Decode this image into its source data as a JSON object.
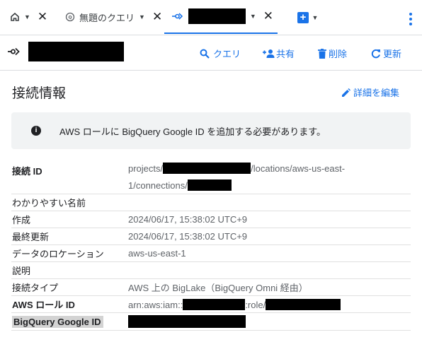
{
  "tabs": [
    {
      "id": "home",
      "icon": "home-icon"
    },
    {
      "id": "query",
      "label": "無題のクエリ",
      "icon": "query-icon"
    },
    {
      "id": "connection",
      "icon": "connection-icon",
      "active": true
    }
  ],
  "toolbar": {
    "query_label": "クエリ",
    "share_label": "共有",
    "delete_label": "削除",
    "refresh_label": "更新"
  },
  "page": {
    "title": "接続情報",
    "edit_label": "詳細を編集"
  },
  "notice": {
    "text": "AWS ロールに BigQuery Google ID を追加する必要があります。"
  },
  "details": {
    "connection_id": {
      "label": "接続 ID",
      "prefix": "projects/",
      "middle": "/locations/aws-us-east-",
      "line2": "1/connections/"
    },
    "friendly_name": {
      "label": "わかりやすい名前"
    },
    "created": {
      "label": "作成",
      "value": "2024/06/17, 15:38:02 UTC+9"
    },
    "last_modified": {
      "label": "最終更新",
      "value": "2024/06/17, 15:38:02 UTC+9"
    },
    "data_location": {
      "label": "データのロケーション",
      "value": "aws-us-east-1"
    },
    "description": {
      "label": "説明"
    },
    "connection_type": {
      "label": "接続タイプ",
      "value": "AWS 上の BigLake（BigQuery Omni 経由）"
    },
    "aws_role_id": {
      "label": "AWS ロール ID",
      "prefix": "arn:aws:iam::",
      "middle": ":role/"
    },
    "bigquery_google_id": {
      "label": "BigQuery Google ID"
    }
  },
  "colors": {
    "accent": "#1a73e8",
    "text": "#202124",
    "muted": "#5f6368",
    "notice_bg": "#f1f3f4"
  }
}
